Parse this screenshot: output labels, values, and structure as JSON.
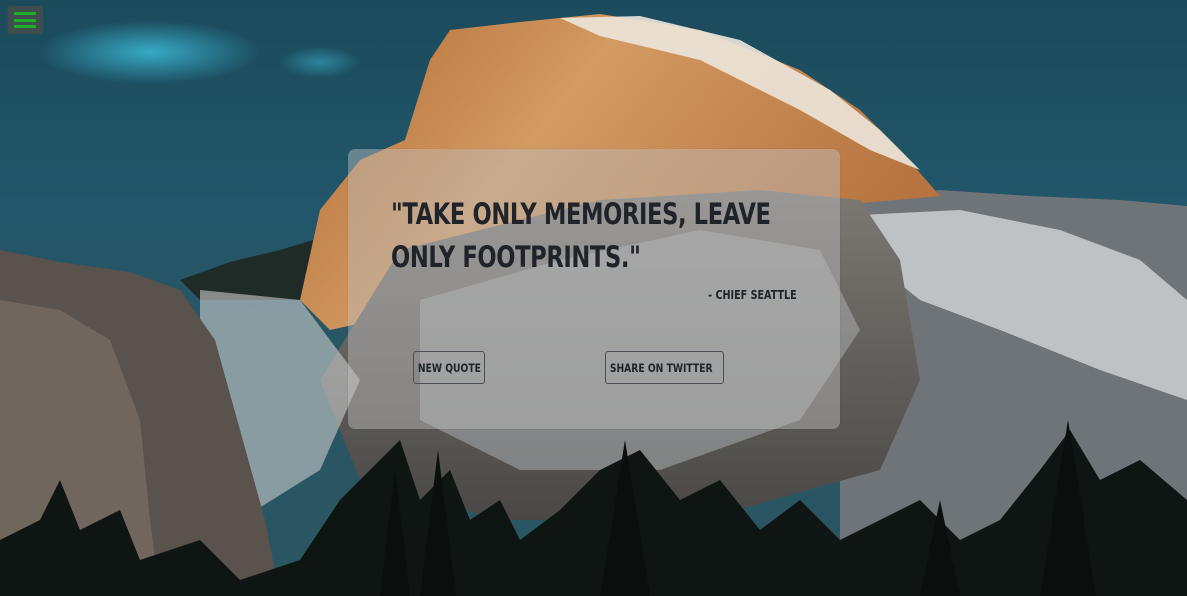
{
  "background": {
    "description_icon": "mountain-landscape-photo",
    "colors": {
      "sky": "#1e5c6e",
      "rock_lit": "#c98a52",
      "snow": "#e6e6e2",
      "trees": "#0e1412"
    }
  },
  "menu": {
    "icon": "hamburger-icon",
    "color": "#1fae2a"
  },
  "quote": {
    "text": "\"Take only memories, leave only footprints.\"",
    "author": "- Chief Seattle"
  },
  "buttons": {
    "new_quote": "New Quote",
    "share": "Share on Twitter",
    "share_icon": "twitter-icon"
  }
}
